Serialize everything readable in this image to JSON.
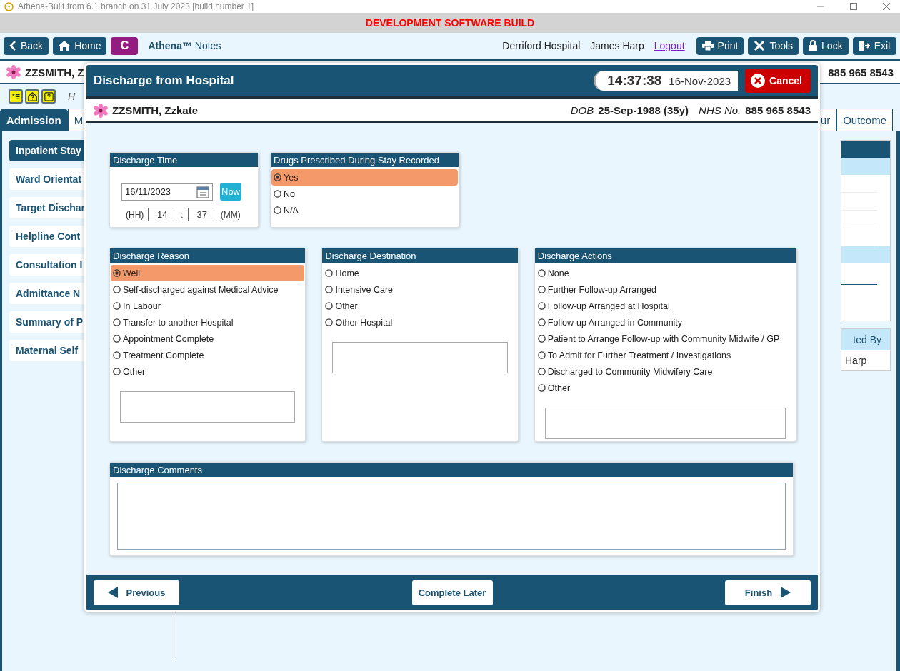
{
  "title_bar": {
    "title": "Athena-Built from 6.1 branch on 31 July 2023 [build number 1]"
  },
  "banner": {
    "text": "DEVELOPMENT SOFTWARE BUILD"
  },
  "toolbar": {
    "left_buttons": [
      {
        "kind": "back",
        "label": "Back"
      },
      {
        "kind": "home",
        "label": "Home"
      }
    ],
    "badge": "C",
    "app_name": "**Athena™** Notes",
    "hospital": "Derriford Hospital",
    "user": "James Harp",
    "logout": "Logout",
    "right_buttons": [
      {
        "kind": "print",
        "label": "Print"
      },
      {
        "kind": "tools",
        "label": "Tools"
      },
      {
        "kind": "lock",
        "label": "Lock"
      },
      {
        "kind": "exit",
        "label": "Exit"
      }
    ]
  },
  "patient_bar": {
    "name": "ZZSMITH, Z",
    "nhs": "885 965 8543"
  },
  "help_row": {
    "text": "H"
  },
  "tabs": [
    {
      "label": "Admission",
      "selected": true
    },
    {
      "label": "M",
      "selected": false
    },
    {
      "label": "ur",
      "selected": false
    },
    {
      "label": "Outcome",
      "selected": false
    }
  ],
  "sidebar": {
    "items": [
      {
        "label": "Inpatient Stay",
        "selected": true
      },
      {
        "label": "Ward Orientat",
        "selected": false
      },
      {
        "label": "Target Dischar",
        "selected": false
      },
      {
        "label": "Helpline Cont",
        "selected": false
      },
      {
        "label": "Consultation I",
        "selected": false
      },
      {
        "label": "Admittance N",
        "selected": false
      },
      {
        "label": "Summary of P",
        "selected": false
      },
      {
        "label": "Maternal Self",
        "selected": false
      }
    ]
  },
  "side_table": {
    "header": "ted By",
    "cell": "Harp"
  },
  "modal": {
    "title": "Discharge from Hospital",
    "time": "14:37:38",
    "date": "16-Nov-2023",
    "cancel": "Cancel",
    "patient": {
      "name": "ZZSMITH, Zzkate",
      "dob_label": "DOB",
      "dob": "25-Sep-1988 (35y)",
      "nhs_label": "NHS No.",
      "nhs": "885 965 8543"
    },
    "discharge_time": {
      "title": "Discharge Time",
      "date": "16/11/2023",
      "now": "Now",
      "hh_label": "(HH)",
      "hh": "14",
      "separator": ":",
      "mm": "37",
      "mm_label": "(MM)"
    },
    "drugs": {
      "title": "Drugs Prescribed During Stay Recorded",
      "options": [
        {
          "label": "Yes",
          "selected": true
        },
        {
          "label": "No",
          "selected": false
        },
        {
          "label": "N/A",
          "selected": false
        }
      ]
    },
    "groups": [
      {
        "title": "Discharge Reason",
        "options": [
          {
            "label": "Well",
            "selected": true
          },
          {
            "label": "Self-discharged against Medical Advice",
            "selected": false
          },
          {
            "label": "In Labour",
            "selected": false
          },
          {
            "label": "Transfer to another Hospital",
            "selected": false
          },
          {
            "label": "Appointment Complete",
            "selected": false
          },
          {
            "label": "Treatment Complete",
            "selected": false
          },
          {
            "label": "Other",
            "selected": false
          }
        ]
      },
      {
        "title": "Discharge Destination",
        "options": [
          {
            "label": "Home",
            "selected": false
          },
          {
            "label": "Intensive Care",
            "selected": false
          },
          {
            "label": "Other",
            "selected": false
          },
          {
            "label": "Other Hospital",
            "selected": false
          }
        ]
      },
      {
        "title": "Discharge Actions",
        "options": [
          {
            "label": "None",
            "selected": false
          },
          {
            "label": "Further Follow-up Arranged",
            "selected": false
          },
          {
            "label": "Follow-up Arranged at Hospital",
            "selected": false
          },
          {
            "label": "Follow-up Arranged in Community",
            "selected": false
          },
          {
            "label": "Patient to Arrange Follow-up with Community Midwife / GP",
            "selected": false
          },
          {
            "label": "To Admit for Further Treatment / Investigations",
            "selected": false
          },
          {
            "label": "Discharged to Community Midwifery Care",
            "selected": false
          },
          {
            "label": "Other",
            "selected": false
          }
        ]
      }
    ],
    "comments": {
      "title": "Discharge Comments"
    },
    "footer": {
      "previous": "Previous",
      "complete_later": "Complete Later",
      "finish": "Finish"
    }
  }
}
